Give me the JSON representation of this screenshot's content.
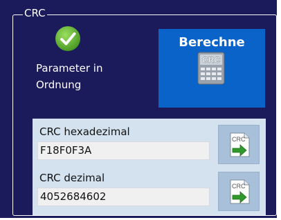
{
  "group": {
    "title": "CRC"
  },
  "status": {
    "text_line1": "Parameter in",
    "text_line2": "Ordnung",
    "icon": "check-circle-icon",
    "color": "#6bbf3a"
  },
  "calculate": {
    "label": "Berechne",
    "icon_text": "CRC",
    "icon": "crc-calculator-icon",
    "color": "#0a63c8"
  },
  "hex": {
    "label": "CRC hexadezimal",
    "value": "F18F0F3A",
    "copy_icon_text": "CRC",
    "copy_icon": "crc-copy-arrow-icon"
  },
  "dec": {
    "label": "CRC dezimal",
    "value": "4052684602",
    "copy_icon_text": "CRC",
    "copy_icon": "crc-copy-arrow-icon"
  },
  "colors": {
    "panel_bg": "#1b1b5c",
    "results_bg": "#d4e2ef",
    "copy_button_bg": "#a8c0d9"
  }
}
